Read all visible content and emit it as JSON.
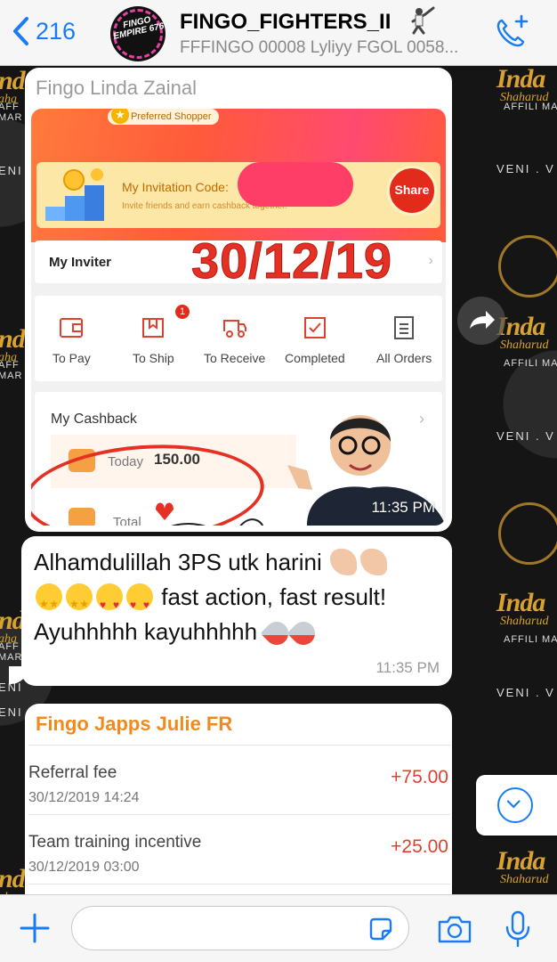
{
  "header": {
    "back_count": "216",
    "group_name": "FINGO_FIGHTERS_II",
    "members": "FFFINGO 00008 Lyliyy FGOL 0058...",
    "avatar_text": "FINGO EMPIRE 676"
  },
  "wallpaper": {
    "brand": "Inda",
    "brand_sub": "Shaharud",
    "affiliate": "AFFILI MARKE",
    "veni": "VENI . V",
    "veni_left": "ENI",
    "aff_left": "AFF MAR",
    "brand_left": "nd",
    "brand_left_sub": "aha"
  },
  "messages": [
    {
      "sender": "Fingo Linda Zainal",
      "type": "image",
      "time": "11:35 PM",
      "image": {
        "preferred": "Preferred Shopper",
        "invite_title": "My Invitation Code:",
        "invite_sub": "Invite friends and earn cashback together.",
        "share": "Share",
        "inviter_label": "My Inviter",
        "date_overlay": "30/12/19",
        "orders": [
          {
            "label": "To Pay",
            "icon": "wallet-icon"
          },
          {
            "label": "To Ship",
            "icon": "box-icon",
            "badge": "1"
          },
          {
            "label": "To Receive",
            "icon": "truck-icon"
          },
          {
            "label": "Completed",
            "icon": "check-box-icon"
          },
          {
            "label": "All Orders",
            "icon": "list-icon"
          }
        ],
        "cashback_title": "My Cashback",
        "today_label": "Today",
        "today_value": "150.00",
        "total_label": "Total"
      }
    },
    {
      "type": "text",
      "line1": "Alhamdulillah 3PS utk harini",
      "line2": "fast action, fast result!",
      "line3": "Ayuhhhhh kayuhhhhh",
      "time": "11:35 PM"
    },
    {
      "sender": "Fingo Japps Julie FR",
      "type": "image",
      "transactions": [
        {
          "label": "Referral fee",
          "date": "30/12/2019 14:24",
          "amount": "+75.00"
        },
        {
          "label": "Team training incentive",
          "date": "30/12/2019 03:00",
          "amount": "+25.00"
        }
      ]
    }
  ],
  "composer": {
    "placeholder": ""
  },
  "colors": {
    "accent": "#1a7cf5",
    "sender_orange": "#f08a1d",
    "sender_gray": "#9b9b9b",
    "overlay_red": "#e53024"
  }
}
